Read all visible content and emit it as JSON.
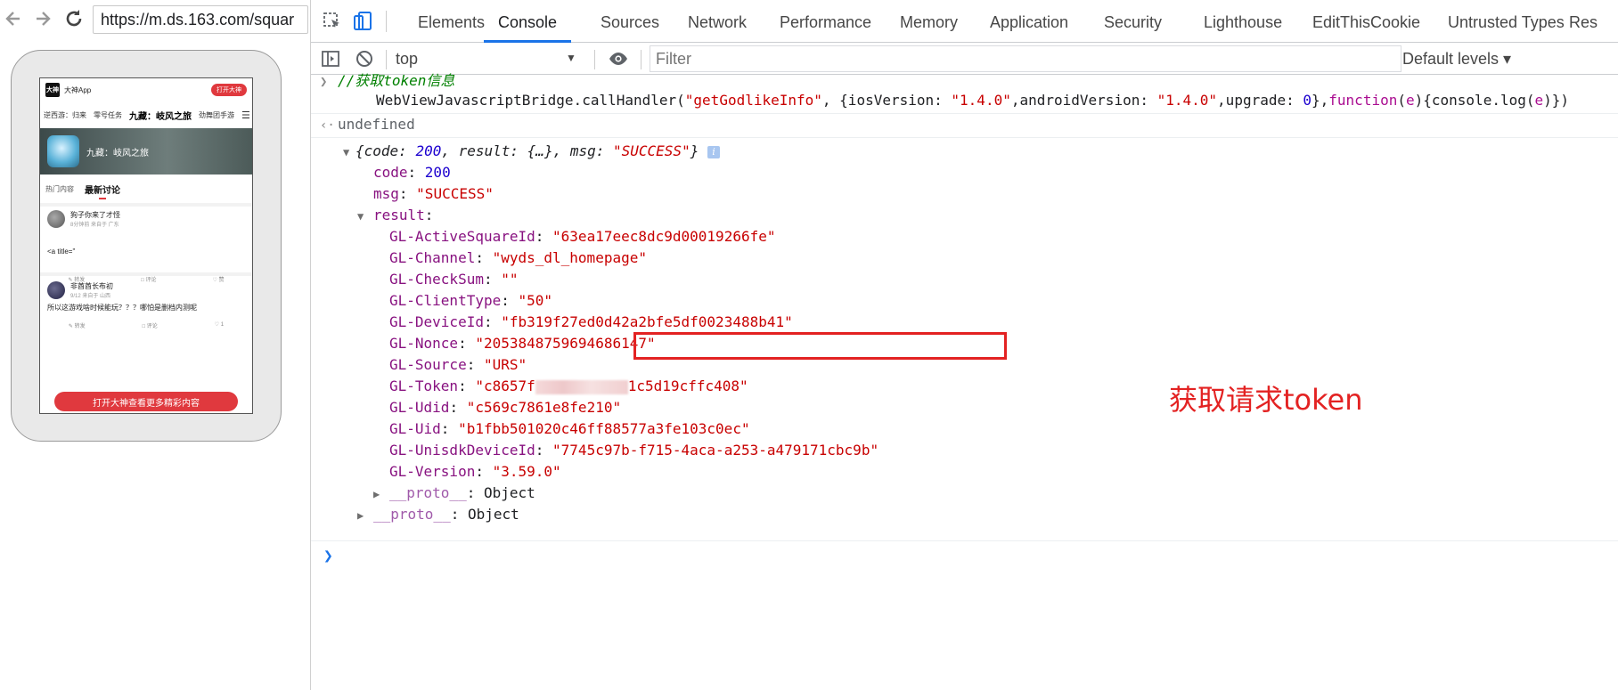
{
  "browser": {
    "url": "https://m.ds.163.com/squar"
  },
  "phone": {
    "app_name": "大神App",
    "logo_text": "大神",
    "open_button": "打开大神",
    "tabs": [
      "逆西游：归来",
      "零号任务",
      "九藏：岐风之旅",
      "劲舞团手游"
    ],
    "game_name": "九藏：岐风之旅",
    "subtabs": [
      "热门内容",
      "最新讨论"
    ],
    "posts": [
      {
        "user": "狗子你来了才怪",
        "meta": "8分钟前 来自于 广东",
        "text": "<a title=\"",
        "actions": [
          "转发",
          "评论",
          "赞"
        ]
      },
      {
        "user": "非酋酋长布初",
        "meta": "9/12 来自于 山西",
        "text": "所以这游戏啥时候能玩？？？哪怕是删档内测呢",
        "actions": [
          "转发",
          "评论",
          "1"
        ]
      }
    ],
    "cta": "打开大神查看更多精彩内容"
  },
  "devtools": {
    "tabs": [
      "Elements",
      "Console",
      "Sources",
      "Network",
      "Performance",
      "Memory",
      "Application",
      "Security",
      "Lighthouse",
      "EditThisCookie",
      "Untrusted Types",
      "Res"
    ],
    "active_tab": "Console",
    "context": "top",
    "filter_placeholder": "Filter",
    "levels": "Default levels ▾"
  },
  "console": {
    "comment": "//获取token信息",
    "call": {
      "object": "WebViewJavascriptBridge.callHandler(",
      "handler": "\"getGodlikeInfo\"",
      "ios_key": ", {iosVersion: ",
      "ios_val": "\"1.4.0\"",
      "android_key": ",androidVersion: ",
      "android_val": "\"1.4.0\"",
      "upgrade_key": ",upgrade: ",
      "upgrade_val": "0",
      "cb_open": "},",
      "cb_kw": "function",
      "cb_args_open": "(",
      "cb_arg": "e",
      "cb_mid": "){console.log(",
      "cb_arg2": "e",
      "cb_close": ")})"
    },
    "return_value": "undefined",
    "summary": {
      "open": "{code: ",
      "code": "200",
      "mid": ", result: {…}, msg: ",
      "msg": "\"SUCCESS\"",
      "close": "}"
    },
    "code_key": "code",
    "code_val": "200",
    "msg_key": "msg",
    "msg_val": "\"SUCCESS\"",
    "result_key": "result",
    "entries": [
      {
        "key": "GL-ActiveSquareId",
        "value": "\"63ea17eec8dc9d00019266fe\""
      },
      {
        "key": "GL-Channel",
        "value": "\"wyds_dl_homepage\""
      },
      {
        "key": "GL-CheckSum",
        "value": "\"\""
      },
      {
        "key": "GL-ClientType",
        "value": "\"50\""
      },
      {
        "key": "GL-DeviceId",
        "value": "\"fb319f27ed0d42a2bfe5df0023488b41\""
      },
      {
        "key": "GL-Nonce",
        "value": "\"2053848759694686147\""
      },
      {
        "key": "GL-Source",
        "value": "\"URS\""
      }
    ],
    "token": {
      "key": "GL-Token",
      "value_start": "\"c8657f",
      "value_end": "1c5d19cffc408\""
    },
    "entries_after": [
      {
        "key": "GL-Udid",
        "value": "\"c569c7861e8fe210\""
      },
      {
        "key": "GL-Uid",
        "value": "\"b1fbb501020c46ff88577a3fe103c0ec\""
      },
      {
        "key": "GL-UnisdkDeviceId",
        "value": "\"7745c97b-f715-4aca-a253-a479171cbc9b\""
      },
      {
        "key": "GL-Version",
        "value": "\"3.59.0\""
      }
    ],
    "proto_key": "__proto__",
    "proto_val": "Object"
  },
  "annotation": "获取请求token",
  "colors": {
    "highlight": "#e32222",
    "accent": "#1a73e8"
  }
}
